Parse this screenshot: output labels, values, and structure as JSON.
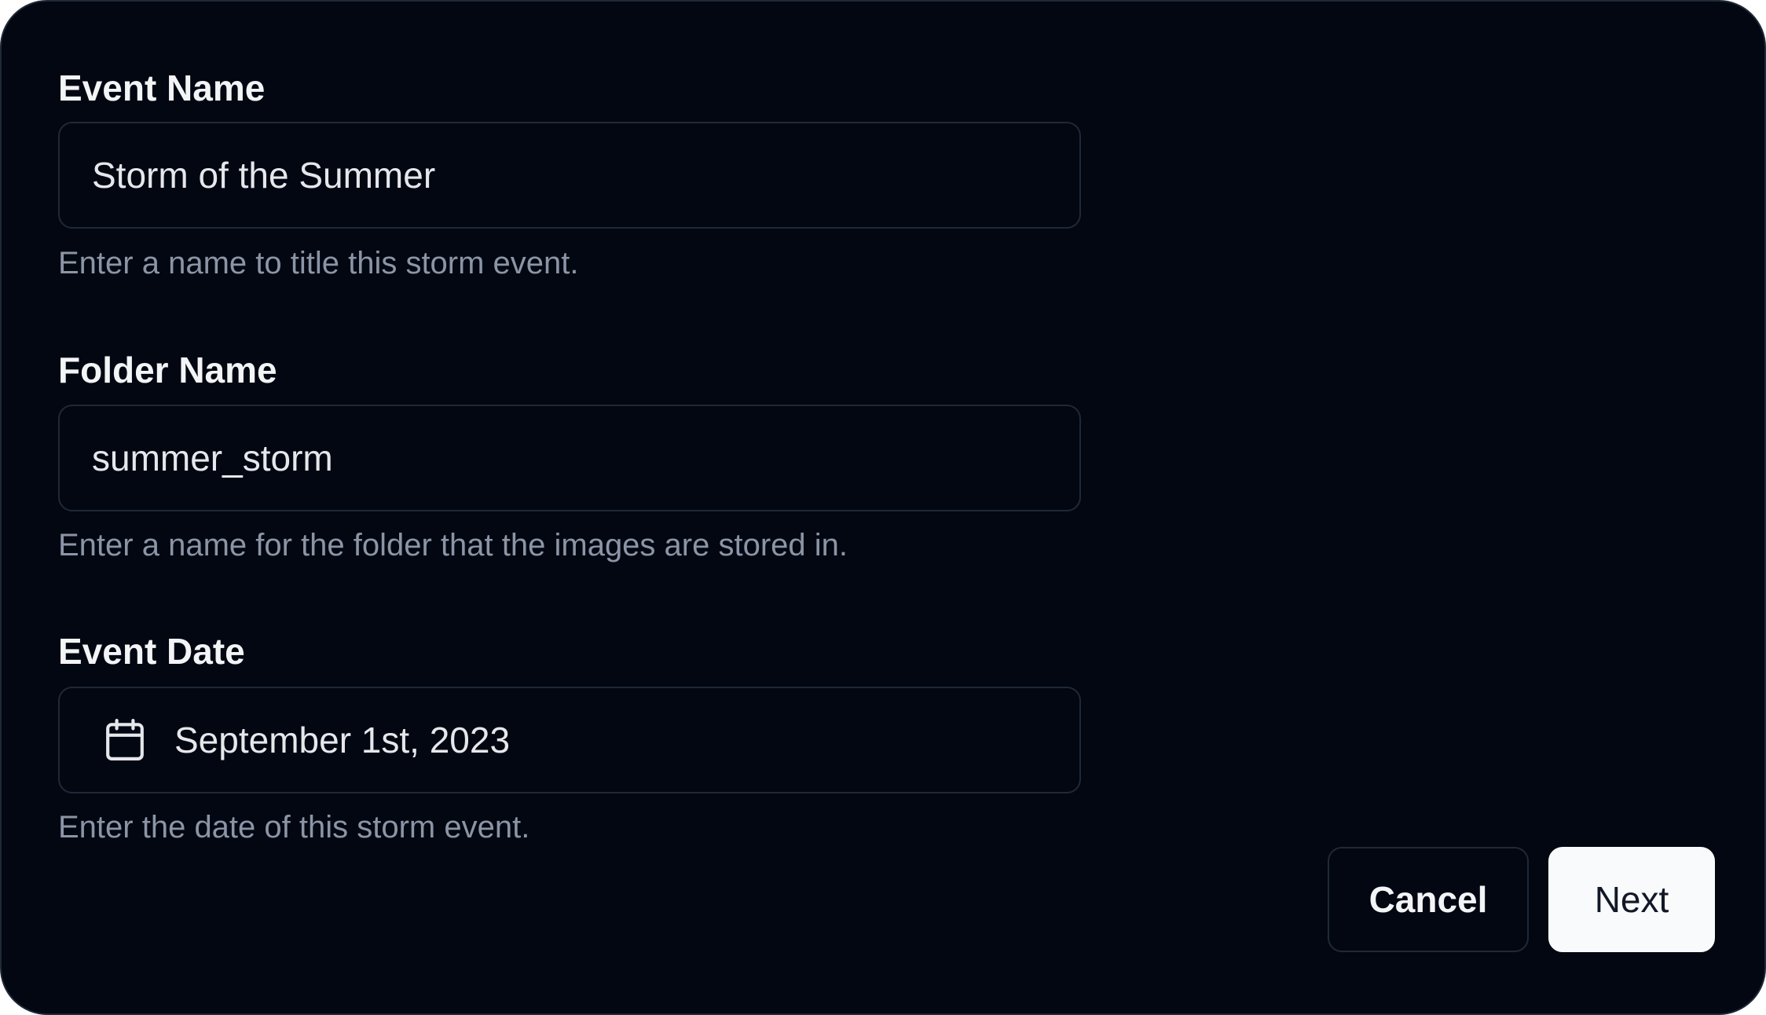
{
  "form": {
    "event_name": {
      "label": "Event Name",
      "value": "Storm of the Summer",
      "help": "Enter a name to title this storm event."
    },
    "folder_name": {
      "label": "Folder Name",
      "value": "summer_storm",
      "help": "Enter a name for the folder that the images are stored in."
    },
    "event_date": {
      "label": "Event Date",
      "value": "September 1st, 2023",
      "icon": "calendar-icon",
      "help": "Enter the date of this storm event."
    }
  },
  "actions": {
    "cancel_label": "Cancel",
    "next_label": "Next"
  },
  "colors": {
    "background": "#030712",
    "border": "#1f2937",
    "text": "#f3f4f6",
    "muted": "#8b95a5",
    "primary_button_bg": "#f9fafb",
    "primary_button_text": "#111827"
  }
}
